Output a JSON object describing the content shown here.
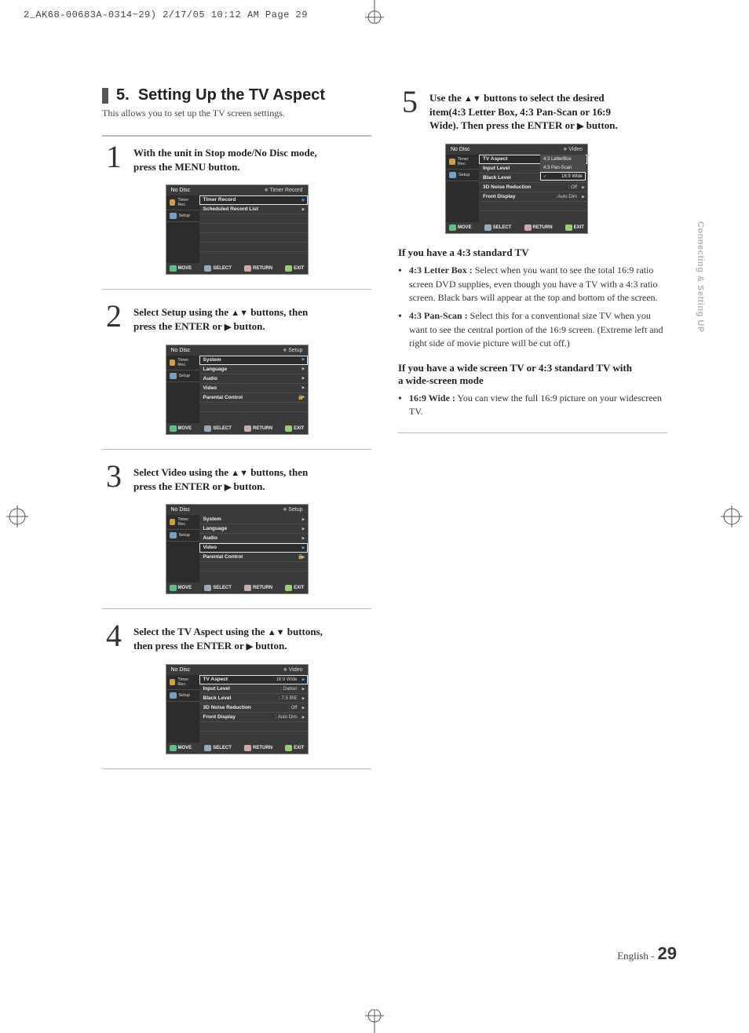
{
  "print_header": "2_AK68-00683A-0314~29)  2/17/05  10:12 AM  Page 29",
  "section": {
    "number": "5.",
    "title": "Setting Up the TV Aspect",
    "subtitle": "This allows you to set up the TV screen settings."
  },
  "legend": {
    "move": "MOVE",
    "select": "SELECT",
    "return": "RETURN",
    "exit": "EXIT"
  },
  "sidebar": {
    "timer": "Timer Rec.",
    "setup": "Setup",
    "nodisc": "No Disc"
  },
  "steps": {
    "s1": {
      "num": "1",
      "text_a": "With the unit in Stop mode/No Disc mode,",
      "text_b": "press the MENU button.",
      "osd_crumb": "Timer Record",
      "rows": [
        "Timer Record",
        "Scheduled Record List"
      ]
    },
    "s2": {
      "num": "2",
      "text_a": "Select Setup using the ",
      "text_b": " buttons, then",
      "text_c": "press the ENTER or ",
      "text_d": " button.",
      "osd_crumb": "Setup",
      "rows": [
        "System",
        "Language",
        "Audio",
        "Video",
        "Parental Control"
      ],
      "sel": 0
    },
    "s3": {
      "num": "3",
      "text_a": "Select Video using the ",
      "text_b": " buttons, then",
      "text_c": "press the ENTER or ",
      "text_d": " button.",
      "osd_crumb": "Setup",
      "rows": [
        "System",
        "Language",
        "Audio",
        "Video",
        "Parental Control"
      ],
      "sel": 3
    },
    "s4": {
      "num": "4",
      "text_a": "Select the TV Aspect using the ",
      "text_b": " buttons,",
      "text_c": "then press the ENTER or ",
      "text_d": " button.",
      "osd_crumb": "Video",
      "rows": [
        {
          "l": "TV Aspect",
          "v": ": 16:9 Wide"
        },
        {
          "l": "Input Level",
          "v": ": Darker"
        },
        {
          "l": "Black Level",
          "v": ": 7.5 IRE"
        },
        {
          "l": "3D Noise Reduction",
          "v": ": Off"
        },
        {
          "l": "Front Display",
          "v": ": Auto Dim"
        }
      ],
      "sel": 0
    },
    "s5": {
      "num": "5",
      "text_a": "Use the ",
      "text_b": " buttons to select the desired",
      "text_c": "item(4:3 Letter Box, 4:3 Pan-Scan or 16:9",
      "text_d": "Wide). Then press the ENTER or ",
      "text_e": " button.",
      "osd_crumb": "Video",
      "rows": [
        {
          "l": "TV Aspect",
          "v": ""
        },
        {
          "l": "Input Level",
          "v": ""
        },
        {
          "l": "Black Level",
          "v": ""
        },
        {
          "l": "3D Noise Reduction",
          "v": ": Off"
        },
        {
          "l": "Front Display",
          "v": ": Auto Dim"
        }
      ],
      "opts": [
        "4:3 LetterBox",
        "4:3 Pan-Scan",
        "16:9 Wide"
      ],
      "opt_sel": 2
    }
  },
  "right": {
    "h1": "If you have a 4:3 standard TV",
    "b1_lead": "4:3 Letter Box :",
    "b1_body": " Select when you want to see the total 16:9 ratio screen DVD supplies, even though you have a TV with a 4:3 ratio screen. Black bars will appear at the top and bottom of the screen.",
    "b2_lead": "4:3 Pan-Scan :",
    "b2_body": " Select this for a conventional size TV when you want to see the central portion of the 16:9 screen. (Extreme left and right side of movie picture will be cut off.)",
    "h2a": "If you have a wide screen TV or 4:3 standard TV with",
    "h2b": "a wide-screen mode",
    "b3_lead": "16:9 Wide :",
    "b3_body": " You can view the full 16:9 picture on your widescreen TV."
  },
  "side_tab": "Connecting & Setting UP",
  "footer": {
    "lang": "English -",
    "page": "29"
  }
}
